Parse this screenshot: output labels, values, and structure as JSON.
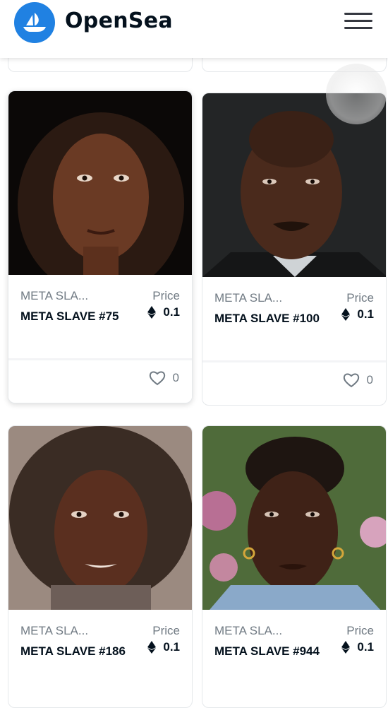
{
  "header": {
    "brand": "OpenSea"
  },
  "labels": {
    "price": "Price"
  },
  "cards": [
    {
      "collection": "META SLA...",
      "name": "META SLAVE #75",
      "price": "0.1",
      "likes": "0"
    },
    {
      "collection": "META SLA...",
      "name": "META SLAVE #100",
      "price": "0.1",
      "likes": "0"
    },
    {
      "collection": "META SLA...",
      "name": "META SLAVE #186",
      "price": "0.1"
    },
    {
      "collection": "META SLA...",
      "name": "META SLAVE #944",
      "price": "0.1"
    }
  ],
  "colors": {
    "brand": "#2081e2",
    "text": "#04111d",
    "muted": "#707a83"
  },
  "icons": {
    "logo": "opensea-boat-icon",
    "menu": "hamburger-menu-icon",
    "currency": "ethereum-icon",
    "favorite": "heart-icon"
  }
}
